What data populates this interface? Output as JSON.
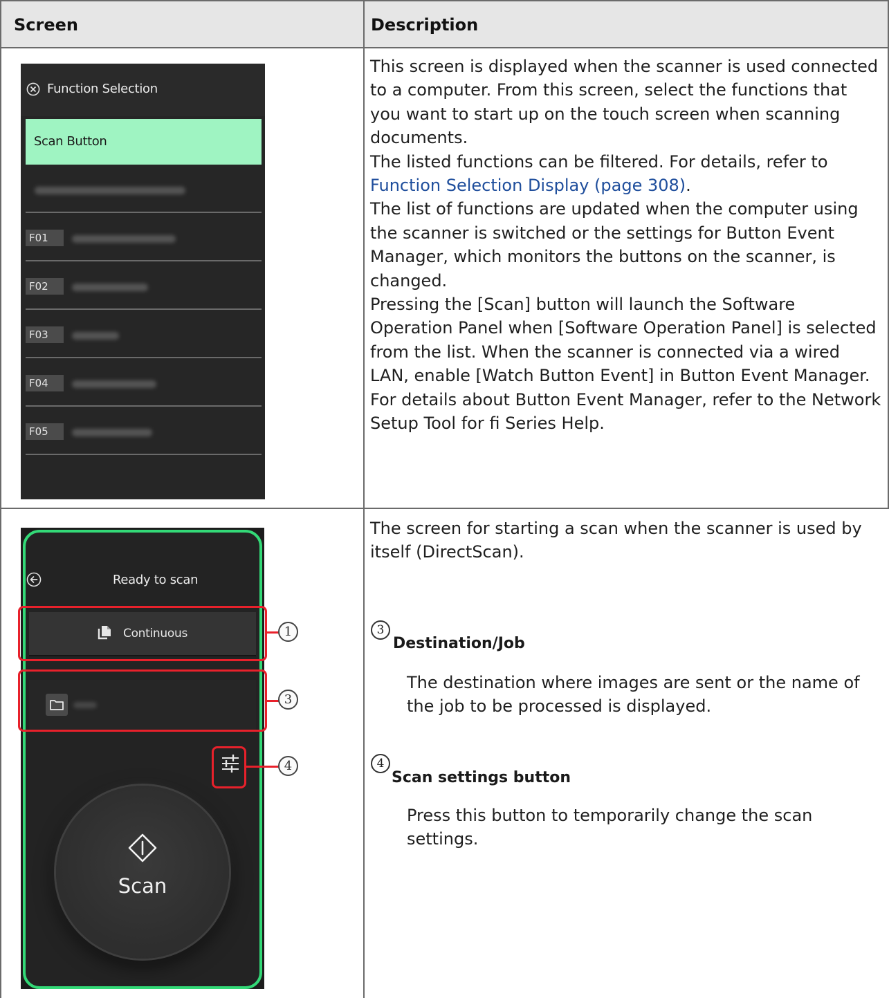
{
  "table": {
    "headers": [
      "Screen",
      "Description"
    ]
  },
  "row1": {
    "panel": {
      "title": "Function Selection",
      "selected_item": "Scan Button",
      "items": [
        {
          "badge": ""
        },
        {
          "badge": "F01"
        },
        {
          "badge": "F02"
        },
        {
          "badge": "F03"
        },
        {
          "badge": "F04"
        },
        {
          "badge": "F05"
        }
      ]
    },
    "description": {
      "p1": "This screen is displayed when the scanner is used connected to a computer. From this screen, select the functions that you want to start up on the touch screen when scanning documents.",
      "p2_text": "The listed functions can be filtered. For details, refer to ",
      "p2_link": "Function Selection Display (page 308)",
      "p2_end": ".",
      "p3": "The list of functions are updated when the computer using the scanner is switched or the settings for Button Event Manager, which monitors the buttons on the scanner, is changed.",
      "p4": "Pressing the [Scan] button will launch the Software Operation Panel when [Software Operation Panel] is selected from the list. When the scanner is connected via a wired LAN, enable [Watch Button Event] in Button Event Manager.",
      "p5": "For details about Button Event Manager, refer to the Network Setup Tool for fi Series Help."
    }
  },
  "row2": {
    "panel": {
      "title": "Ready to scan",
      "continuous_label": "Continuous",
      "scan_label": "Scan"
    },
    "callouts": [
      "1",
      "3",
      "4"
    ],
    "description": {
      "intro": "The screen for starting a scan when the scanner is used by itself (DirectScan).",
      "s3_num": "3",
      "s3_head": "Destination/Job",
      "s3_body": "The destination where images are sent or the name of the job to be processed is displayed.",
      "s4_num": "4",
      "s4_head": "Scan settings button",
      "s4_body": "Press this button to temporarily change the scan settings."
    }
  },
  "colors": {
    "header_bg": "#e6e6e6",
    "highlight_green": "#9ff4c2",
    "frame_green": "#33d977",
    "callout_red": "#e8212b",
    "link_blue": "#1f4e9c"
  }
}
